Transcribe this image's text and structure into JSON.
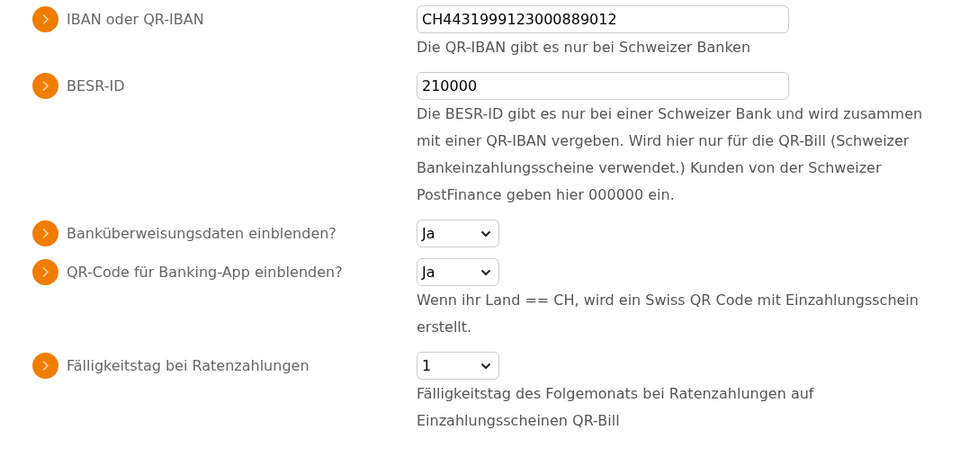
{
  "fields": [
    {
      "label": "IBAN oder QR-IBAN",
      "kind": "input",
      "value": "CH4431999123000889012",
      "help": "Die QR-IBAN gibt es nur bei Schweizer Banken"
    },
    {
      "label": "BESR-ID",
      "kind": "input",
      "value": "210000",
      "help": "Die BESR-ID gibt es nur bei einer Schweizer Bank und wird zusammen mit einer QR-IBAN vergeben. Wird hier nur für die QR-Bill (Schweizer Bankeinzahlungsscheine verwendet.) Kunden von der Schweizer PostFinance geben hier 000000 ein."
    },
    {
      "label": "Banküberweisungsdaten einblenden?",
      "kind": "select",
      "value": "Ja"
    },
    {
      "label": "QR-Code für Banking-App einblenden?",
      "kind": "select",
      "value": "Ja",
      "help": "Wenn ihr Land == CH, wird ein Swiss QR Code mit Einzahlungsschein erstellt."
    },
    {
      "label": "Fälligkeitstag bei Ratenzahlungen",
      "kind": "select",
      "value": "1",
      "help": "Fälligkeitstag des Folgemonats bei Ratenzahlungen auf Einzahlungsscheinen QR-Bill"
    }
  ]
}
